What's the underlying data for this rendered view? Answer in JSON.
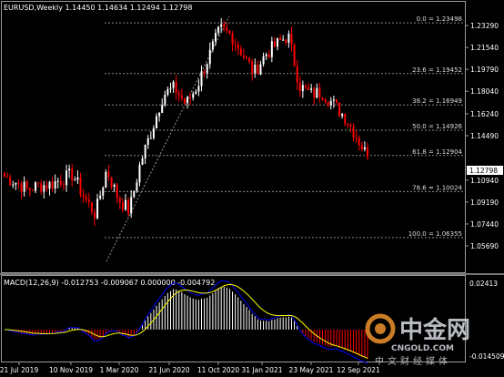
{
  "header": {
    "symbol_timeframe": "EURUSD,Weekly",
    "ohlc": "1.14450 1.14634 1.12494 1.12798"
  },
  "macd": {
    "label": "MACD(12,26,9) -0.012753 -0.009067 0.000000 -0.004792"
  },
  "fib_levels": [
    {
      "label": "0.0 = 1.23498",
      "price": 1.23498
    },
    {
      "label": "23.6 = 1.19452",
      "price": 1.19452
    },
    {
      "label": "38.2 = 1.16949",
      "price": 1.16949
    },
    {
      "label": "50.0 = 1.14926",
      "price": 1.14926
    },
    {
      "label": "61.8 = 1.12904",
      "price": 1.12904
    },
    {
      "label": "78.6 = 1.10024",
      "price": 1.10024
    },
    {
      "label": "100.0 = 1.06355",
      "price": 1.06355
    }
  ],
  "price_axis": [
    "1.23290",
    "1.21540",
    "1.19790",
    "1.18040",
    "1.16240",
    "1.14490",
    "1.10940",
    "1.09190",
    "1.07440",
    "1.05690"
  ],
  "current_price": "1.12798",
  "macd_axis": [
    "0.02413",
    "-0.014509"
  ],
  "time_axis": [
    "21 Jul 2019",
    "10 Nov 2019",
    "1 Mar 2020",
    "21 Jun 2020",
    "11 Oct 2020",
    "31 Jan 2021",
    "23 May 2021",
    "12 Sep 2021"
  ],
  "watermark": {
    "brand_cn": "中金网",
    "url": "CNGOLD.COM",
    "sub_cn": "中文财经媒体"
  },
  "colors": {
    "background": "#000000",
    "bull_candle": "#ffffff",
    "bear_candle": "#ff0000",
    "grid": "#808080",
    "macd_line": "#0000ff",
    "signal_line": "#ffff00",
    "hist_positive": "#ffffff",
    "hist_negative": "#ff0000",
    "price_tag": "#ffffff"
  },
  "chart_data": {
    "type": "candlestick",
    "symbol": "EURUSD",
    "timeframe": "Weekly",
    "ylim": [
      1.0569,
      1.2373
    ],
    "points": [
      {
        "t": "21 Jul 2019",
        "close": 1.112
      },
      {
        "t": "",
        "close": 1.108
      },
      {
        "t": "",
        "close": 1.102
      },
      {
        "t": "",
        "close": 1.105
      },
      {
        "t": "10 Nov 2019",
        "close": 1.106
      },
      {
        "t": "",
        "close": 1.11
      },
      {
        "t": "",
        "close": 1.114
      },
      {
        "t": "",
        "close": 1.096
      },
      {
        "t": "1 Mar 2020",
        "close": 1.082
      },
      {
        "t": "",
        "close": 1.118
      },
      {
        "t": "",
        "close": 1.095
      },
      {
        "t": "",
        "close": 1.085
      },
      {
        "t": "",
        "close": 1.124
      },
      {
        "t": "",
        "close": 1.15
      },
      {
        "t": "21 Jun 2020",
        "close": 1.178
      },
      {
        "t": "",
        "close": 1.183
      },
      {
        "t": "",
        "close": 1.17
      },
      {
        "t": "",
        "close": 1.185
      },
      {
        "t": "11 Oct 2020",
        "close": 1.208
      },
      {
        "t": "",
        "close": 1.23
      },
      {
        "t": "",
        "close": 1.225
      },
      {
        "t": "",
        "close": 1.21
      },
      {
        "t": "31 Jan 2021",
        "close": 1.195
      },
      {
        "t": "",
        "close": 1.21
      },
      {
        "t": "",
        "close": 1.218
      },
      {
        "t": "",
        "close": 1.225
      },
      {
        "t": "23 May 2021",
        "close": 1.185
      },
      {
        "t": "",
        "close": 1.178
      },
      {
        "t": "",
        "close": 1.18
      },
      {
        "t": "",
        "close": 1.17
      },
      {
        "t": "12 Sep 2021",
        "close": 1.16
      },
      {
        "t": "",
        "close": 1.145
      },
      {
        "t": "",
        "close": 1.12798
      }
    ]
  }
}
